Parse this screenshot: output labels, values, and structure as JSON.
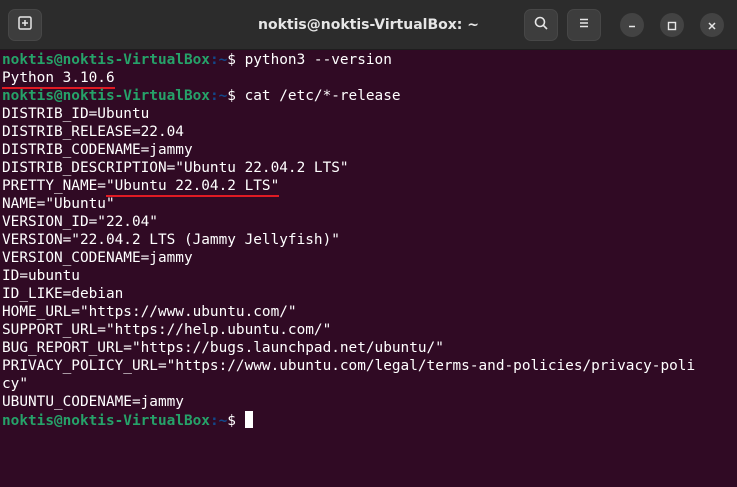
{
  "window": {
    "title": "noktis@noktis-VirtualBox: ~"
  },
  "colors": {
    "background": "#300a24",
    "prompt_user": "#26a269",
    "prompt_path": "#12488b",
    "annotation": "#e01b24"
  },
  "icons": {
    "new_tab": "new-tab-icon",
    "search": "search-icon",
    "menu": "hamburger-menu-icon",
    "minimize": "minimize-icon",
    "maximize": "maximize-icon",
    "close": "close-icon"
  },
  "prompt": {
    "user_host": "noktis@noktis-VirtualBox",
    "path_sep": ":~",
    "symbol": "$ "
  },
  "commands": {
    "c1": "python3 --version",
    "c2": "cat /etc/*-release"
  },
  "output": {
    "python_version": "Python 3.10.6",
    "l1": "DISTRIB_ID=Ubuntu",
    "l2": "DISTRIB_RELEASE=22.04",
    "l3": "DISTRIB_CODENAME=jammy",
    "l4": "DISTRIB_DESCRIPTION=\"Ubuntu 22.04.2 LTS\"",
    "l5_key": "PRETTY_NAME=",
    "l5_val": "\"Ubuntu 22.04.2 LTS\"",
    "l6": "NAME=\"Ubuntu\"",
    "l7": "VERSION_ID=\"22.04\"",
    "l8": "VERSION=\"22.04.2 LTS (Jammy Jellyfish)\"",
    "l9": "VERSION_CODENAME=jammy",
    "l10": "ID=ubuntu",
    "l11": "ID_LIKE=debian",
    "l12": "HOME_URL=\"https://www.ubuntu.com/\"",
    "l13": "SUPPORT_URL=\"https://help.ubuntu.com/\"",
    "l14": "BUG_REPORT_URL=\"https://bugs.launchpad.net/ubuntu/\"",
    "l15a": "PRIVACY_POLICY_URL=\"https://www.ubuntu.com/legal/terms-and-policies/privacy-poli",
    "l15b": "cy\"",
    "l16": "UBUNTU_CODENAME=jammy"
  }
}
